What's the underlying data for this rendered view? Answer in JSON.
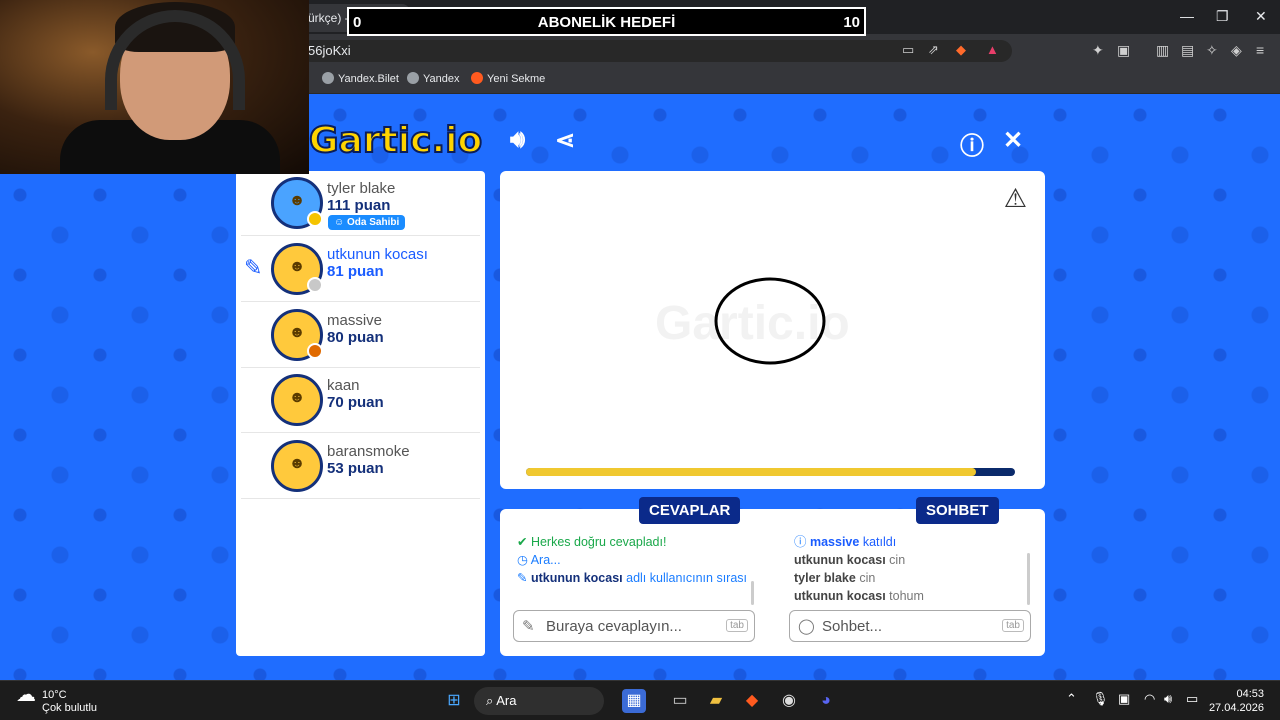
{
  "browser": {
    "tab_title": "ürkçe) - Gartic.io",
    "tab_close": "✕",
    "new_tab": "+",
    "url": "56joKxi",
    "bookmarks": [
      "Yandex.Bilet",
      "Yandex",
      "Yeni Sekme"
    ],
    "window_controls": [
      "—",
      "❐",
      "✕"
    ]
  },
  "goal_overlay": {
    "start": "0",
    "title": "ABONELİK HEDEFİ",
    "target": "10"
  },
  "game": {
    "logo": "Gartic.io",
    "players": [
      {
        "name": "tyler blake",
        "score": "111 puan",
        "badge": "Oda Sahibi",
        "status_color": "#f5c400"
      },
      {
        "name": "utkunun kocası",
        "score": "81 puan",
        "drawing": true,
        "status_color": "#c8c8c8"
      },
      {
        "name": "massive",
        "score": "80 puan",
        "status_color": "#e06a00"
      },
      {
        "name": "kaan",
        "score": "70 puan"
      },
      {
        "name": "baransmoke",
        "score": "53 puan"
      }
    ],
    "canvas_watermark": "Gartic.io",
    "timer_progress": 0.92,
    "answers": {
      "label": "CEVAPLAR",
      "log": [
        {
          "type": "ok",
          "text": "Herkes doğru cevapladı!"
        },
        {
          "type": "info",
          "text": "Ara..."
        },
        {
          "type": "turn",
          "user": "utkunun kocası",
          "text": "adlı kullanıcının sırası"
        }
      ],
      "placeholder": "Buraya cevaplayın...",
      "hint": "tab"
    },
    "chat": {
      "label": "SOHBET",
      "log": [
        {
          "type": "join",
          "user": "massive",
          "text": "katıldı"
        },
        {
          "user": "utkunun kocası",
          "text": "cin"
        },
        {
          "user": "tyler blake",
          "text": "cin"
        },
        {
          "user": "utkunun kocası",
          "text": "tohum"
        }
      ],
      "placeholder": "Sohbet...",
      "hint": "tab"
    }
  },
  "taskbar": {
    "weather_temp": "10°C",
    "weather_desc": "Çok bulutlu",
    "search": "Ara",
    "time": "04:53",
    "date": "27.04.2026"
  }
}
